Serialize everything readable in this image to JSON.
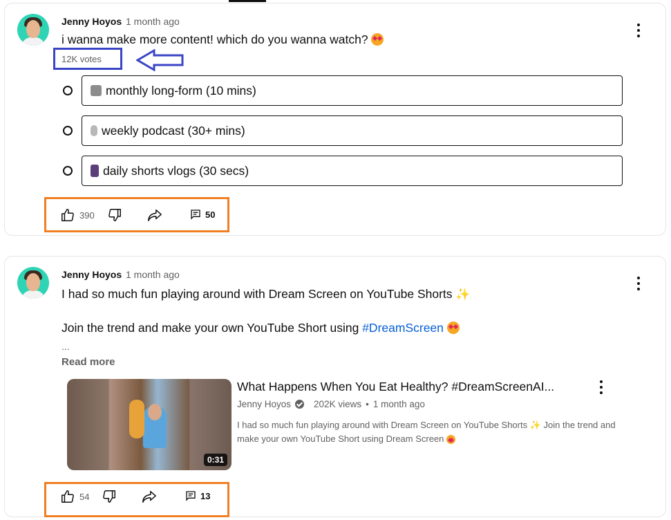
{
  "post1": {
    "author": "Jenny Hoyos",
    "time": "1 month ago",
    "text": "i wanna make more content! which do you wanna watch?",
    "votes": "12K votes",
    "options": [
      {
        "icon": "camera-icon",
        "label": "monthly long-form (10 mins)"
      },
      {
        "icon": "microphone-icon",
        "label": "weekly podcast (30+ mins)"
      },
      {
        "icon": "phone-icon",
        "label": "daily shorts vlogs (30 secs)"
      }
    ],
    "likes": "390",
    "comments": "50"
  },
  "post2": {
    "author": "Jenny Hoyos",
    "time": "1 month ago",
    "line1": "I had so much fun playing around with Dream Screen on YouTube Shorts",
    "line2_prefix": "Join the trend and make your own YouTube Short using ",
    "hashtag": "#DreamScreen",
    "ellipsis": "...",
    "read_more": "Read more",
    "video": {
      "title": "What Happens When You Eat Healthy? #DreamScreenAI...",
      "channel": "Jenny Hoyos",
      "views": "202K views",
      "separator": "•",
      "age": "1 month ago",
      "description": "I had so much fun playing around with Dream Screen on YouTube Shorts ✨ Join the trend and make your own YouTube Short using Dream Screen",
      "duration": "0:31"
    },
    "likes": "54",
    "comments": "13"
  },
  "colors": {
    "annotation_blue": "#3a45c6",
    "annotation_orange": "#f07f23",
    "link": "#065fd4",
    "muted": "#606060"
  }
}
